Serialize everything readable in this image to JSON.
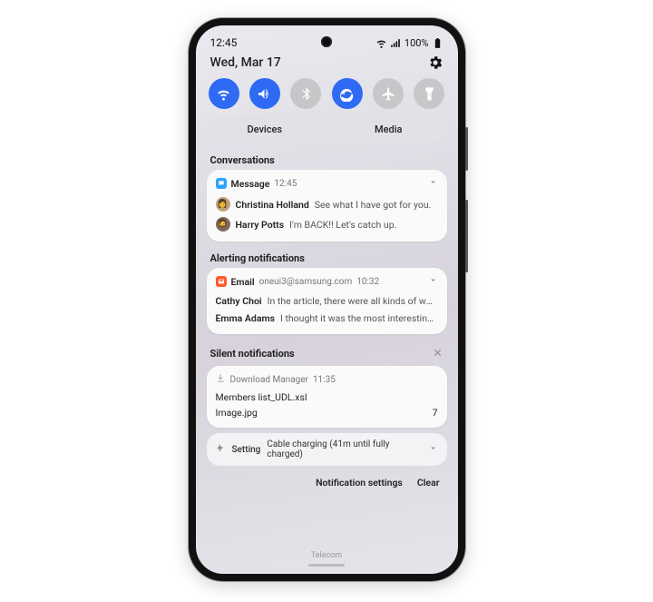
{
  "status": {
    "time": "12:45",
    "battery": "100%"
  },
  "date": "Wed, Mar 17",
  "quick": {
    "devices_label": "Devices",
    "media_label": "Media"
  },
  "sections": {
    "conversations": "Conversations",
    "alerting": "Alerting notifications",
    "silent": "Silent notifications"
  },
  "msg": {
    "app": "Message",
    "time": "12:45",
    "items": [
      {
        "sender": "Christina Holland",
        "preview": "See what I have got for you."
      },
      {
        "sender": "Harry Potts",
        "preview": "I'm BACK!! Let's catch up."
      }
    ]
  },
  "email": {
    "app": "Email",
    "account": "oneui3@samsung.com",
    "time": "10:32",
    "items": [
      {
        "sender": "Cathy Choi",
        "preview": "In the article, there were all kinds of wond…"
      },
      {
        "sender": "Emma Adams",
        "preview": "I thought it was the most interesting th…"
      }
    ]
  },
  "download": {
    "app": "Download Manager",
    "time": "11:35",
    "files": [
      {
        "name": "Members list_UDL.xsl",
        "count": ""
      },
      {
        "name": "Image.jpg",
        "count": "7"
      }
    ]
  },
  "setting": {
    "label": "Setting",
    "text": "Cable charging (41m until fully charged)"
  },
  "footer": {
    "settings": "Notification settings",
    "clear": "Clear",
    "carrier": "Telecom"
  }
}
